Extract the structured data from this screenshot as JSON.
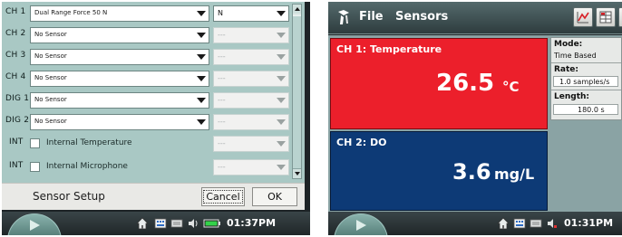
{
  "sensor_setup": {
    "rows": [
      {
        "channel": "CH 1",
        "sensor": "Dual Range Force 50 N",
        "unit": "N"
      },
      {
        "channel": "CH 2",
        "sensor": "No Sensor",
        "unit": "---"
      },
      {
        "channel": "CH 3",
        "sensor": "No Sensor",
        "unit": "---"
      },
      {
        "channel": "CH 4",
        "sensor": "No Sensor",
        "unit": "---"
      },
      {
        "channel": "DIG 1",
        "sensor": "No Sensor",
        "unit": "---"
      },
      {
        "channel": "DIG 2",
        "sensor": "No Sensor",
        "unit": "---"
      },
      {
        "channel": "INT",
        "sensor": "Internal Temperature",
        "unit": "---"
      },
      {
        "channel": "INT",
        "sensor": "Internal Microphone",
        "unit": "---"
      }
    ],
    "title": "Sensor Setup",
    "cancel_label": "Cancel",
    "ok_label": "OK"
  },
  "left_taskbar": {
    "clock": "01:37PM"
  },
  "meter_app": {
    "menu_file": "File",
    "menu_sensors": "Sensors",
    "meters": [
      {
        "label": "CH 1: Temperature",
        "value": "26.5",
        "unit": "°C",
        "color": "#ec1f2b"
      },
      {
        "label": "CH 2: DO",
        "value": "3.6",
        "unit": "mg/L",
        "color": "#0d3a76"
      }
    ],
    "info": {
      "mode_key": "Mode:",
      "mode_val": "Time Based",
      "rate_key": "Rate:",
      "rate_val": "1.0 samples/s",
      "length_key": "Length:",
      "length_val": "180.0 s"
    }
  },
  "right_taskbar": {
    "clock": "01:31PM"
  },
  "icons": [
    "dropdown-arrow-icon",
    "checkbox-icon",
    "scroll-up-icon",
    "scroll-down-icon",
    "start-play-icon",
    "home-icon",
    "keyboard-icon",
    "volume-icon",
    "battery-icon",
    "app-logo-icon",
    "graph-view-icon",
    "table-view-icon"
  ]
}
